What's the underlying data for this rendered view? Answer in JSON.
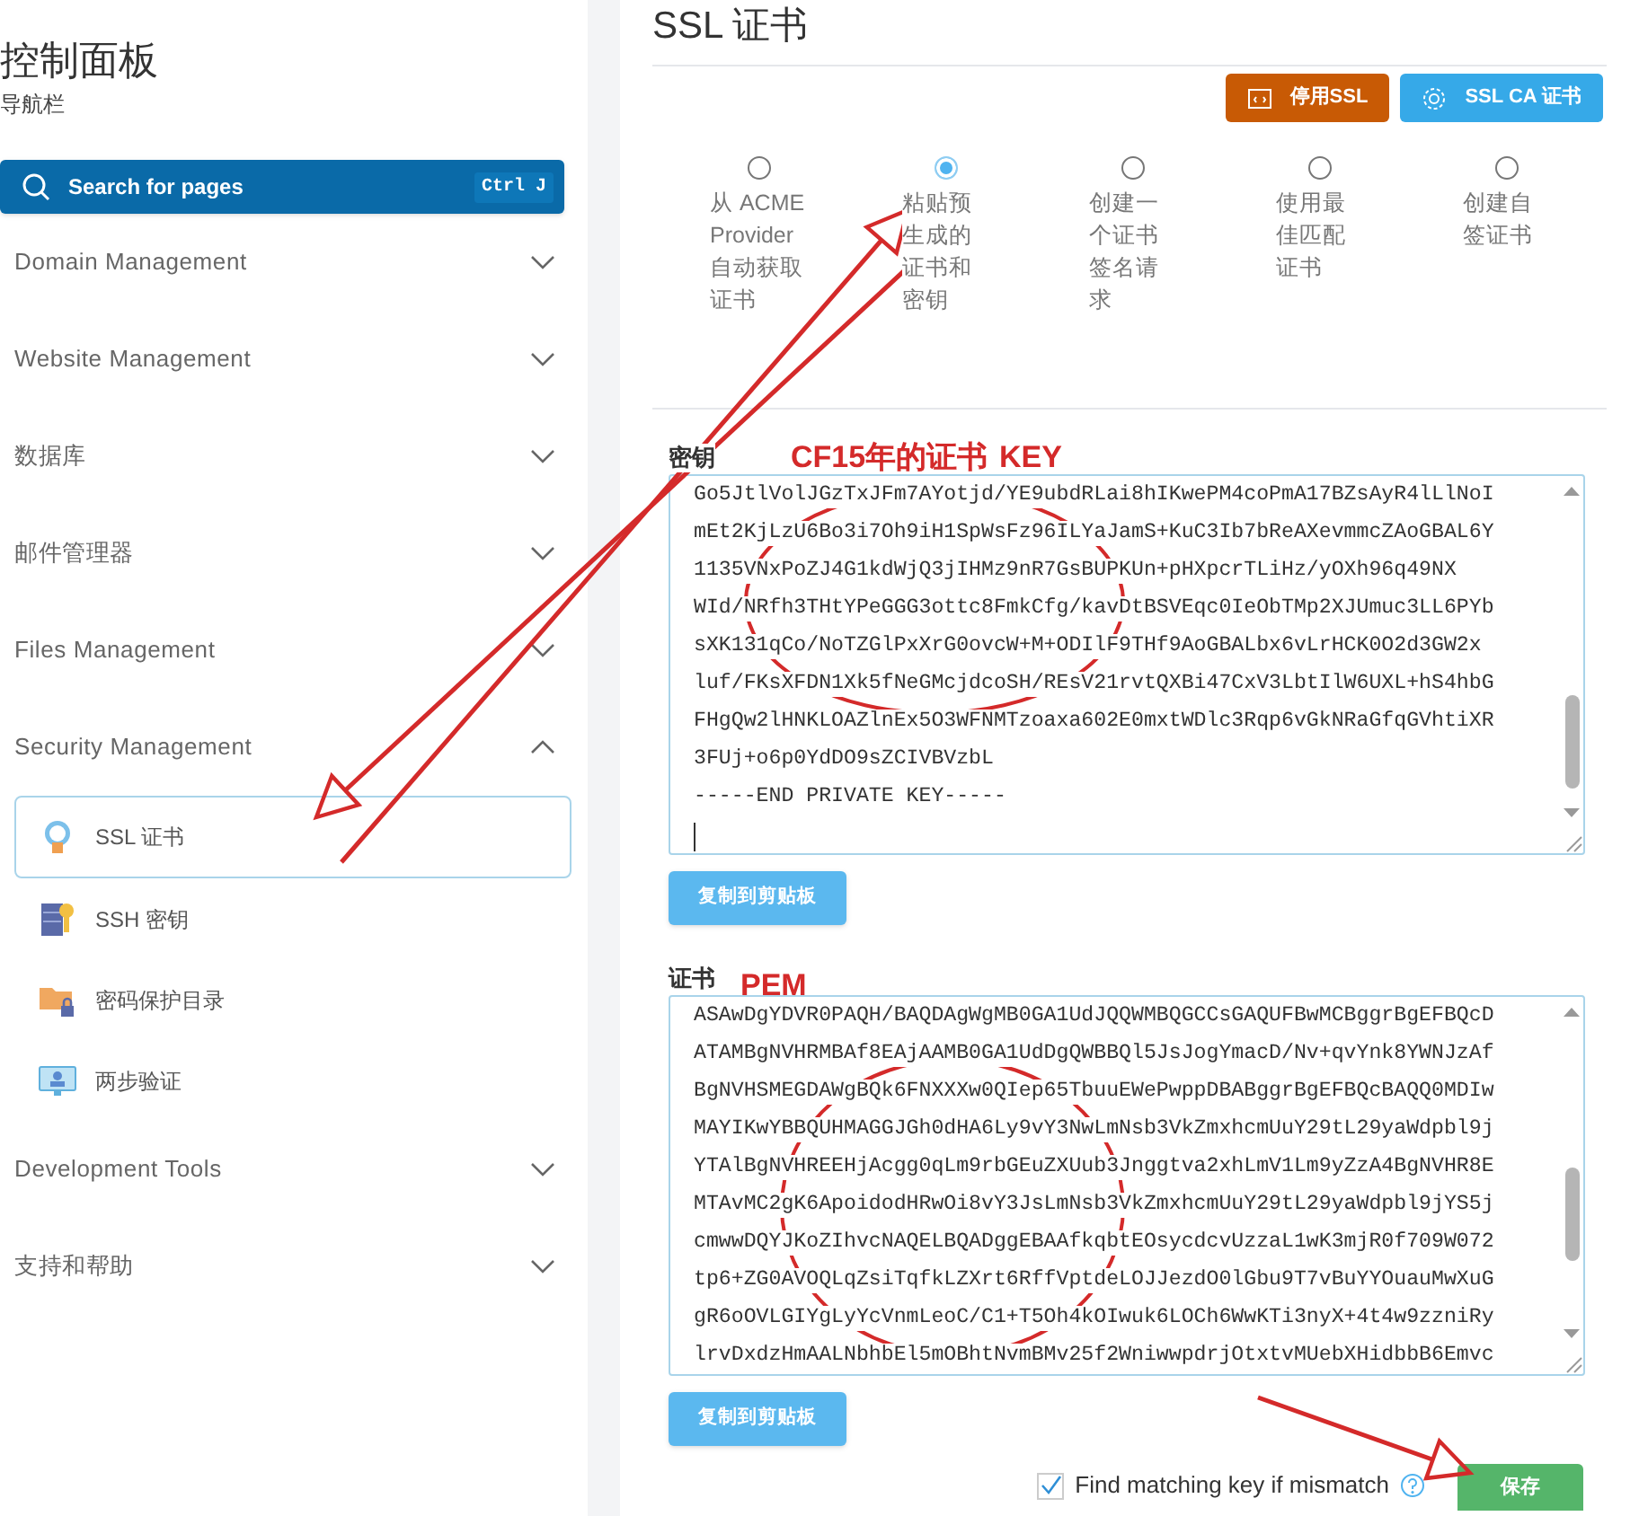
{
  "sidebar": {
    "title": "控制面板",
    "subtitle": "导航栏",
    "search": {
      "placeholder": "Search for pages",
      "shortcut": "Ctrl J"
    },
    "sections": [
      {
        "label": "Domain Management",
        "expanded": false
      },
      {
        "label": "Website Management",
        "expanded": false
      },
      {
        "label": "数据库",
        "expanded": false
      },
      {
        "label": "邮件管理器",
        "expanded": false
      },
      {
        "label": "Files Management",
        "expanded": false
      },
      {
        "label": "Security Management",
        "expanded": true,
        "children": [
          {
            "label": "SSL 证书",
            "selected": true
          },
          {
            "label": "SSH 密钥",
            "selected": false
          },
          {
            "label": "密码保护目录",
            "selected": false
          },
          {
            "label": "两步验证",
            "selected": false
          }
        ]
      },
      {
        "label": "Development Tools",
        "expanded": false
      },
      {
        "label": "支持和帮助",
        "expanded": false
      }
    ]
  },
  "main": {
    "title": "SSL 证书",
    "actions": [
      {
        "label": "停用SSL",
        "kind": "warning"
      },
      {
        "label": "SSL CA 证书",
        "kind": "info"
      }
    ],
    "options": [
      {
        "label": "从 ACME Provider 自动获取证书",
        "selected": false
      },
      {
        "label": "粘贴预生成的证书和密钥",
        "selected": true
      },
      {
        "label": "创建一个证书签名请求",
        "selected": false
      },
      {
        "label": "使用最佳匹配证书",
        "selected": false
      },
      {
        "label": "创建自签证书",
        "selected": false
      }
    ],
    "fields": [
      {
        "label": "密钥",
        "copy_button": "复制到剪贴板",
        "lines": [
          "Go5JtlVolJGzTxJFm7AYotjd/YE9ubdRLai8hIKwePM4coPmA17BZsAyR4lLlNoI",
          "mEt2KjLzU6Bo3i7Oh9iH1SpWsFz96ILYaJamS+KuC3Ib7bReAXevmmcZAoGBAL6Y",
          "1135VNxPoZJ4G1kdWjQ3jIHMz9nR7GsBUPKUn+pHXpcrTLiHz/yOXh96q49NX",
          "WId/NRfh3THtYPeGGG3ottc8FmkCfg/kavDtBSVEqc0IeObTMp2XJUmuc3LL6PYb",
          "sXK131qCo/NoTZGlPxXrG0ovcW+M+ODIlF9THf9AoGBALbx6vLrHCK0O2d3GW2x",
          "luf/FKsXFDN1Xk5fNeGMcjdcoSH/REsV21rvtQXBi47CxV3LbtIlW6UXL+hS4hbG",
          "FHgQw2lHNKLOAZlnEx5O3WFNMTzoaxa602E0mxtWDlc3Rqp6vGkNRaGfqGVhtiXR",
          "3FUj+o6p0YdDO9sZCIVBVzbL",
          "-----END PRIVATE KEY-----"
        ]
      },
      {
        "label": "证书",
        "copy_button": "复制到剪贴板",
        "lines": [
          "ASAwDgYDVR0PAQH/BAQDAgWgMB0GA1UdJQQWMBQGCCsGAQUFBwMCBggrBgEFBQcD",
          "ATAMBgNVHRMBAf8EAjAAMB0GA1UdDgQWBBQl5JsJogYmacD/Nv+qvYnk8YWNJzAf",
          "BgNVHSMEGDAWgBQk6FNXXXw0QIep65TbuuEWePwppDBABggrBgEFBQcBAQQ0MDIw",
          "MAYIKwYBBQUHMAGGJGh0dHA6Ly9vY3NwLmNsb3VkZmxhcmUuY29tL29yaWdpbl9j",
          "YTAlBgNVHREEHjAcgg0qLm9rbGEuZXUub3Jnggtva2xhLmV1Lm9yZzA4BgNVHR8E",
          "MTAvMC2gK6ApoidodHRwOi8vY3JsLmNsb3VkZmxhcmUuY29tL29yaWdpbl9jYS5j",
          "cmwwDQYJKoZIhvcNAQELBQADggEBAAfkqbtEOsycdcvUzzaL1wK3mjR0f709W072",
          "tp6+ZG0AVOQLqZsiTqfkLZXrt6RffVptdeLOJJezdO0lGbu9T7vBuYYOuauMwXuG",
          "gR6oOVLGIYgLyYcVnmLeoC/C1+T5Oh4kOIwuk6LOCh6WwKTi3nyX+4t4w9zzniRy",
          "lrvDxdzHmAALNbhbEl5mOBhtNvmBMv25f2WniwwpdrjOtxtvMUebXHidbbB6Emvc"
        ]
      }
    ],
    "match_checkbox": {
      "label": "Find matching key if mismatch",
      "checked": true
    },
    "save_button": "保存"
  },
  "annotations": [
    {
      "text": "CF15年的证书"
    },
    {
      "text": "KEY"
    },
    {
      "text": "PEM"
    }
  ]
}
